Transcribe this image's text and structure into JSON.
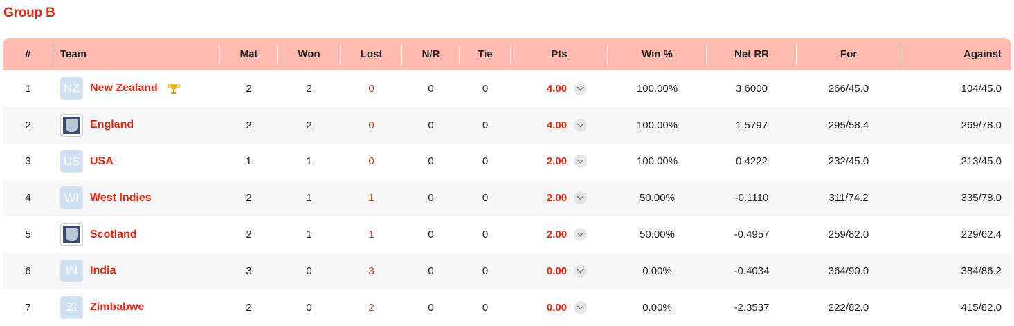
{
  "group_title": "Group B",
  "columns": {
    "pos": "#",
    "team": "Team",
    "mat": "Mat",
    "won": "Won",
    "lost": "Lost",
    "nr": "N/R",
    "tie": "Tie",
    "pts": "Pts",
    "win_pct": "Win %",
    "net_rr": "Net RR",
    "for": "For",
    "against": "Against"
  },
  "colors": {
    "accent": "#e8230f",
    "header_bg": "#ffbbb0",
    "stripe": "#f7f7f7"
  },
  "rows": [
    {
      "pos": "1",
      "flag": "NZ",
      "team": "New Zealand",
      "trophy": true,
      "mat": "2",
      "won": "2",
      "lost": "0",
      "nr": "0",
      "tie": "0",
      "pts": "4.00",
      "win_pct": "100.00%",
      "net_rr": "3.6000",
      "for": "266/45.0",
      "against": "104/45.0"
    },
    {
      "pos": "2",
      "flag": "crest",
      "team": "England",
      "trophy": false,
      "mat": "2",
      "won": "2",
      "lost": "0",
      "nr": "0",
      "tie": "0",
      "pts": "4.00",
      "win_pct": "100.00%",
      "net_rr": "1.5797",
      "for": "295/58.4",
      "against": "269/78.0"
    },
    {
      "pos": "3",
      "flag": "US",
      "team": "USA",
      "trophy": false,
      "mat": "1",
      "won": "1",
      "lost": "0",
      "nr": "0",
      "tie": "0",
      "pts": "2.00",
      "win_pct": "100.00%",
      "net_rr": "0.4222",
      "for": "232/45.0",
      "against": "213/45.0"
    },
    {
      "pos": "4",
      "flag": "WI",
      "team": "West Indies",
      "trophy": false,
      "mat": "2",
      "won": "1",
      "lost": "1",
      "nr": "0",
      "tie": "0",
      "pts": "2.00",
      "win_pct": "50.00%",
      "net_rr": "-0.1110",
      "for": "311/74.2",
      "against": "335/78.0"
    },
    {
      "pos": "5",
      "flag": "crest",
      "team": "Scotland",
      "trophy": false,
      "mat": "2",
      "won": "1",
      "lost": "1",
      "nr": "0",
      "tie": "0",
      "pts": "2.00",
      "win_pct": "50.00%",
      "net_rr": "-0.4957",
      "for": "259/82.0",
      "against": "229/62.4"
    },
    {
      "pos": "6",
      "flag": "IN",
      "team": "India",
      "trophy": false,
      "mat": "3",
      "won": "0",
      "lost": "3",
      "nr": "0",
      "tie": "0",
      "pts": "0.00",
      "win_pct": "0.00%",
      "net_rr": "-0.4034",
      "for": "364/90.0",
      "against": "384/86.2"
    },
    {
      "pos": "7",
      "flag": "ZI",
      "team": "Zimbabwe",
      "trophy": false,
      "mat": "2",
      "won": "0",
      "lost": "2",
      "nr": "0",
      "tie": "0",
      "pts": "0.00",
      "win_pct": "0.00%",
      "net_rr": "-2.3537",
      "for": "222/82.0",
      "against": "415/82.0"
    }
  ]
}
